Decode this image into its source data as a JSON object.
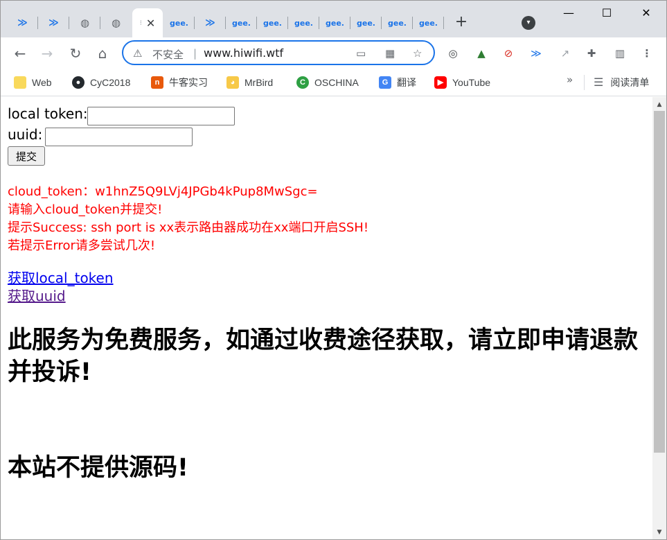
{
  "tabs": [
    {
      "icon": "chevron-stack-icon",
      "label": ""
    },
    {
      "icon": "chevron-stack-icon",
      "label": ""
    },
    {
      "icon": "globe-icon",
      "label": ""
    },
    {
      "icon": "globe-icon",
      "label": ""
    },
    {
      "icon": "blank-page-icon",
      "label": "",
      "active": true
    },
    {
      "icon": "gee-icon",
      "label": "gee."
    },
    {
      "icon": "chevron-stack-icon",
      "label": ""
    },
    {
      "icon": "gee-icon",
      "label": "gee."
    },
    {
      "icon": "gee-icon",
      "label": "gee."
    },
    {
      "icon": "gee-icon",
      "label": "gee."
    },
    {
      "icon": "gee-icon",
      "label": "gee."
    },
    {
      "icon": "gee-icon",
      "label": "gee."
    },
    {
      "icon": "gee-icon",
      "label": "gee."
    },
    {
      "icon": "gee-icon",
      "label": "gee."
    }
  ],
  "omnibox": {
    "security_label": "不安全",
    "url": "www.hiwifi.wtf"
  },
  "bookmarks": [
    {
      "label": "Web",
      "icon": "folder-icon",
      "color": "#f9d95c"
    },
    {
      "label": "CyC2018",
      "icon": "github-icon",
      "color": "#24292e"
    },
    {
      "label": "牛客实习",
      "icon": "nowcoder-icon",
      "color": "#e8590c"
    },
    {
      "label": "MrBird",
      "icon": "bird-icon",
      "color": "#f7c948"
    },
    {
      "label": "OSCHINA",
      "icon": "oschina-icon",
      "color": "#2ea043"
    },
    {
      "label": "翻译",
      "icon": "translate-icon",
      "color": "#4285f4"
    },
    {
      "label": "YouTube",
      "icon": "youtube-icon",
      "color": "#ff0000"
    }
  ],
  "reading_list": "阅读清单",
  "form": {
    "local_token_label": "local token:",
    "local_token_value": "",
    "uuid_label": "uuid:",
    "uuid_value": "",
    "submit_label": "提交"
  },
  "messages": [
    "cloud_token：w1hnZ5Q9LVj4JPGb4kPup8MwSgc=",
    "请输入cloud_token并提交!",
    "提示Success: ssh port is xx表示路由器成功在xx端口开启SSH!",
    "若提示Error请多尝试几次!"
  ],
  "links": {
    "get_local_token": "获取local_token",
    "get_uuid": "获取uuid"
  },
  "headings": {
    "free_notice": "此服务为免费服务，如通过收费途径获取，请立即申请退款并投诉!",
    "no_source": "本站不提供源码!"
  },
  "colors": {
    "accent": "#1a73e8",
    "message_red": "#ff0000",
    "link_blue": "#0000ee",
    "link_visited": "#551a8b"
  }
}
